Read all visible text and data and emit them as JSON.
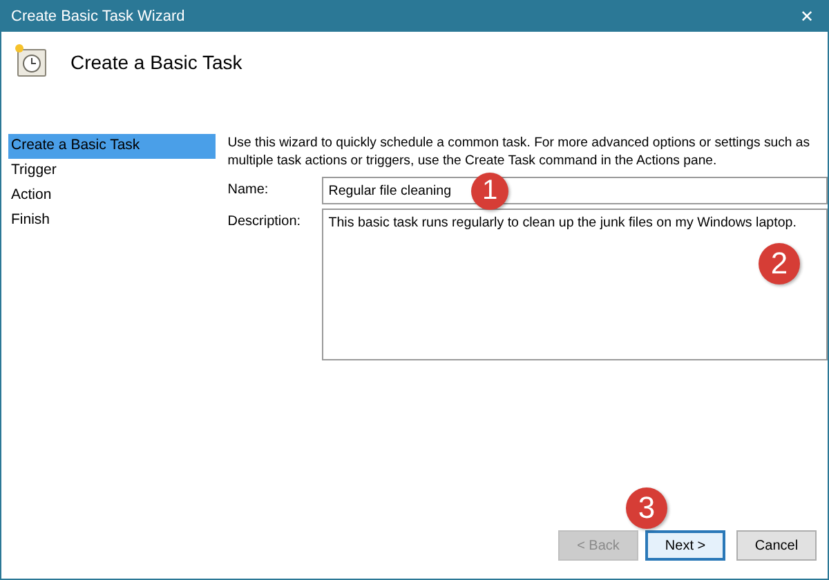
{
  "window": {
    "title": "Create Basic Task Wizard",
    "close": "✕"
  },
  "header": {
    "title": "Create a Basic Task"
  },
  "steps": [
    {
      "label": "Create a Basic Task",
      "selected": true
    },
    {
      "label": "Trigger",
      "selected": false
    },
    {
      "label": "Action",
      "selected": false
    },
    {
      "label": "Finish",
      "selected": false
    }
  ],
  "intro": "Use this wizard to quickly schedule a common task.  For more advanced options or settings such as multiple task actions or triggers, use the Create Task command in the Actions pane.",
  "name_field": {
    "label": "Name:",
    "value": "Regular file cleaning"
  },
  "description_field": {
    "label": "Description:",
    "value": "This basic task runs regularly to clean up the junk files on my Windows laptop."
  },
  "buttons": [
    {
      "label": "< Back",
      "disabled": true,
      "focused": false
    },
    {
      "label": "Next >",
      "disabled": false,
      "focused": true
    },
    {
      "label": "Cancel",
      "disabled": false,
      "focused": false
    }
  ],
  "annotations": [
    {
      "label": "1"
    },
    {
      "label": "2"
    },
    {
      "label": "3"
    }
  ]
}
